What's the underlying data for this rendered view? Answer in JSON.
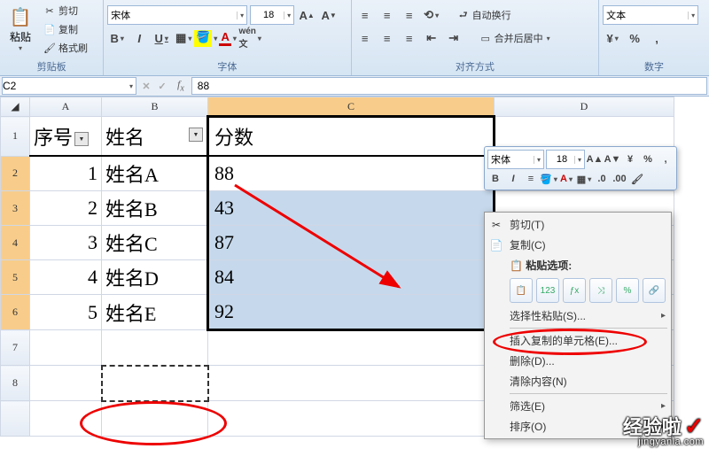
{
  "ribbon": {
    "clipboard": {
      "paste": "粘贴",
      "cut": "剪切",
      "copy": "复制",
      "format_painter": "格式刷",
      "group": "剪贴板"
    },
    "font": {
      "name": "宋体",
      "size": "18",
      "group": "字体"
    },
    "alignment": {
      "wrap": "自动换行",
      "merge": "合并后居中",
      "group": "对齐方式"
    },
    "number": {
      "format": "文本",
      "group": "数字"
    }
  },
  "namebox": "C2",
  "formula": "88",
  "headers": [
    "A",
    "B",
    "C",
    "D"
  ],
  "row_headers": [
    "1",
    "2",
    "3",
    "4",
    "5",
    "6",
    "7",
    "8",
    ""
  ],
  "table": {
    "header": {
      "a": "序号",
      "b": "姓名",
      "c": "分数"
    },
    "rows": [
      {
        "a": "1",
        "b": "姓名A",
        "c": "88"
      },
      {
        "a": "2",
        "b": "姓名B",
        "c": "43"
      },
      {
        "a": "3",
        "b": "姓名C",
        "c": "87"
      },
      {
        "a": "4",
        "b": "姓名D",
        "c": "84"
      },
      {
        "a": "5",
        "b": "姓名E",
        "c": "92"
      }
    ]
  },
  "mini": {
    "font": "宋体",
    "size": "18"
  },
  "context_menu": {
    "cut": "剪切(T)",
    "copy": "复制(C)",
    "paste_options_label": "粘贴选项:",
    "paste_special": "选择性粘贴(S)...",
    "insert_copied": "插入复制的单元格(E)...",
    "delete": "删除(D)...",
    "clear": "清除内容(N)",
    "filter": "筛选(E)",
    "sort": "排序(O)"
  },
  "paste_opts": [
    "📋",
    "123",
    "ƒx",
    "%",
    "🔗"
  ],
  "watermark": {
    "big": "经验啦",
    "small": "jingyanla.com"
  },
  "chart_data": {
    "type": "table",
    "columns": [
      "序号",
      "姓名",
      "分数"
    ],
    "rows": [
      [
        1,
        "姓名A",
        88
      ],
      [
        2,
        "姓名B",
        43
      ],
      [
        3,
        "姓名C",
        87
      ],
      [
        4,
        "姓名D",
        84
      ],
      [
        5,
        "姓名E",
        92
      ]
    ]
  }
}
